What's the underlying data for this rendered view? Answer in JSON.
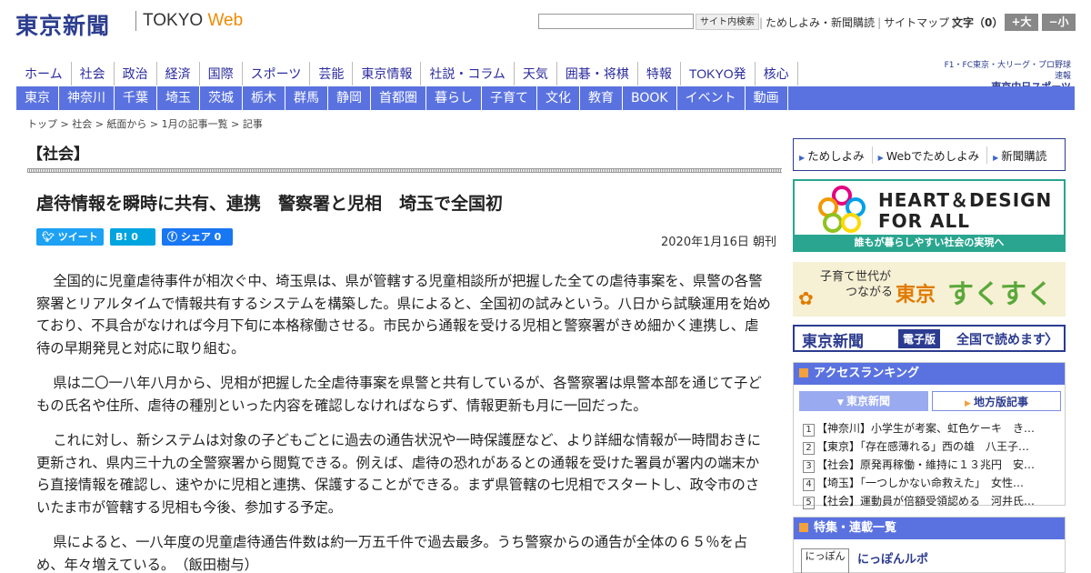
{
  "header": {
    "logo": "東京新聞",
    "logo_sub_a": "TOKYO ",
    "logo_sub_b": "Web",
    "search_btn": "サイト内検索",
    "links": [
      "ためしよみ・新聞購読",
      "サイトマップ"
    ],
    "font_size_label": "文字（0）",
    "font_up": "+大",
    "font_down": "−小"
  },
  "nav_main": [
    "ホーム",
    "社会",
    "政治",
    "経済",
    "国際",
    "スポーツ",
    "芸能",
    "東京情報",
    "社説・コラム",
    "天気",
    "囲碁・将棋",
    "特報",
    "TOKYO発",
    "核心"
  ],
  "chunichi": {
    "top": "F1・FC東京・大リーグ・プロ野球速報",
    "name": "東京中日スポーツ"
  },
  "nav_region": [
    "東京",
    "神奈川",
    "千葉",
    "埼玉",
    "茨城",
    "栃木",
    "群馬",
    "静岡",
    "首都圏",
    "暮らし",
    "子育て",
    "文化",
    "教育",
    "BOOK",
    "イベント",
    "動画"
  ],
  "breadcrumb": [
    "トップ",
    "社会",
    "紙面から",
    "1月の記事一覧",
    "記事"
  ],
  "section": "【社会】",
  "article": {
    "title": "虐待情報を瞬時に共有、連携　警察署と児相　埼玉で全国初",
    "share": {
      "tweet": "ツイート",
      "hatena": "B! 0",
      "facebook": "シェア 0"
    },
    "date": "2020年1月16日 朝刊",
    "paragraphs": [
      "全国的に児童虐待事件が相次ぐ中、埼玉県は、県が管轄する児童相談所が把握した全ての虐待事案を、県警の各警察署とリアルタイムで情報共有するシステムを構築した。県によると、全国初の試みという。八日から試験運用を始めており、不具合がなければ今月下旬に本格稼働させる。市民から通報を受ける児相と警察署がきめ細かく連携し、虐待の早期発見と対応に取り組む。",
      "県は二〇一八年八月から、児相が把握した全虐待事案を県警と共有しているが、各警察署は県警本部を通じて子どもの氏名や住所、虐待の種別といった内容を確認しなければならず、情報更新も月に一回だった。",
      "これに対し、新システムは対象の子どもごとに過去の通告状況や一時保護歴など、より詳細な情報が一時間おきに更新され、県内三十九の全警察署から閲覧できる。例えば、虐待の恐れがあるとの通報を受けた署員が署内の端末から直接情報を確認し、速やかに児相と連携、保護することができる。まず県管轄の七児相でスタートし、政令市のさいたま市が管轄する児相も今後、参加する予定。",
      "県によると、一八年度の児童虐待通告件数は約一万五千件で過去最多。うち警察からの通告が全体の６５％を占め、年々増えている。　（飯田樹与）"
    ]
  },
  "sidebar": {
    "tameshi": [
      "ためしよみ",
      "Webでためしよみ",
      "新聞購読"
    ],
    "heart": {
      "line1": "HEART＆DESIGN",
      "line2": "FOR ALL",
      "bar": "誰もが暮らしやすい社会の実現へ"
    },
    "sukusuku": {
      "s1a": "子育て世代が",
      "s1b": "つながる",
      "s2": "東京",
      "s3": "すくすく"
    },
    "eban": {
      "a": "東京新聞",
      "b": "電子版",
      "c": "全国で読めます",
      "d": "〉"
    },
    "ranking": {
      "title": "アクセスランキング",
      "tab_on": "東京新聞",
      "tab_off": "地方版記事",
      "items": [
        "【神奈川】小学生が考案、虹色ケーキ　き…",
        "【東京】「存在感薄れる」西の雄　八王子…",
        "【社会】原発再稼働・維持に１３兆円　安…",
        "【埼玉】「一つしかない命救えた」　女性…",
        "【社会】運動員が倍額受領認める　河井氏…"
      ]
    },
    "toku": {
      "title": "特集・連載一覧",
      "box": "にっぽん",
      "item": "にっぽんルポ"
    }
  },
  "colors": {
    "nav_blue": "#5a72e0",
    "brand_navy": "#2b3b8f",
    "heart_teal": "#2aa58f",
    "accent_orange": "#f2a13b"
  }
}
